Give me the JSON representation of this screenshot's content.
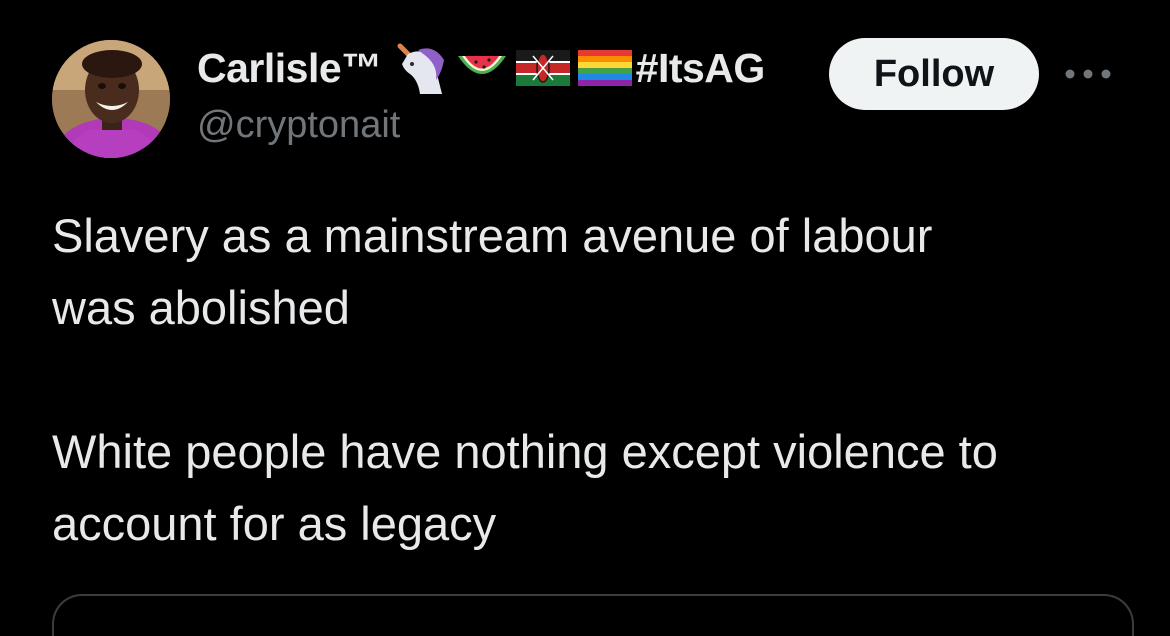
{
  "tweet": {
    "author": {
      "display_name": "Carlisle™",
      "handle": "@cryptonait",
      "emojis": [
        "unicorn-icon",
        "watermelon-icon",
        "kenya-flag-icon",
        "rainbow-flag-icon"
      ],
      "hashtag": "#ItsAG"
    },
    "follow_label": "Follow",
    "text": {
      "paragraph_1_line_1": "Slavery as a mainstream avenue of labour",
      "paragraph_1_line_2": "was abolished",
      "paragraph_2_line_1": "White people have nothing except violence to",
      "paragraph_2_line_2": "account for as legacy"
    }
  },
  "colors": {
    "background": "#000000",
    "text_primary": "#e7e9ea",
    "text_secondary": "#71767b",
    "follow_bg": "#eff3f4",
    "follow_text": "#0f1419"
  }
}
